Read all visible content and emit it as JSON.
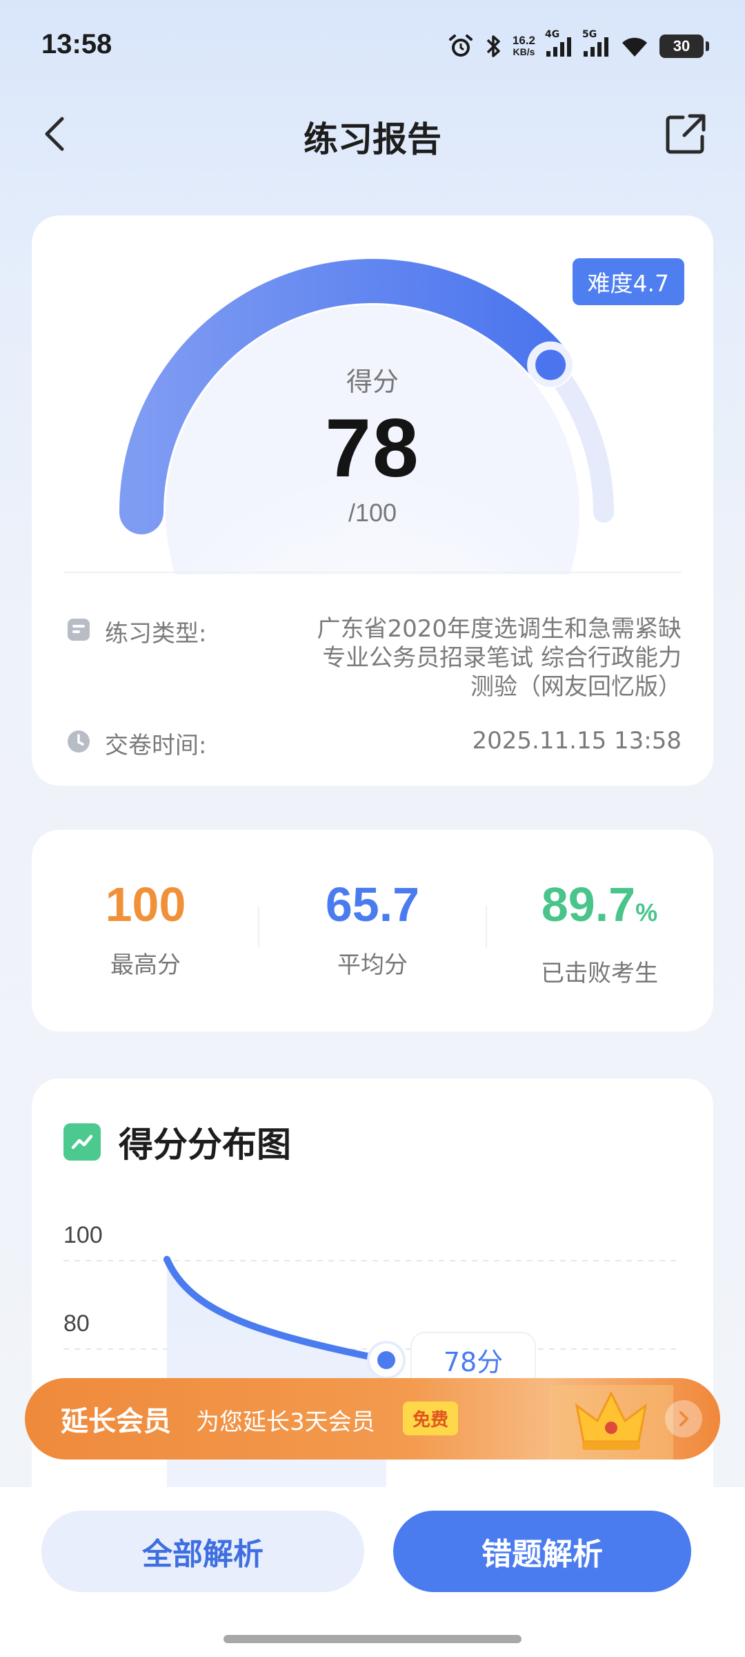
{
  "status_bar": {
    "time": "13:58",
    "network_speed_top": "16.2",
    "network_speed_bottom": "KB/s",
    "signal_1": "4G",
    "signal_2": "5G",
    "battery": "30",
    "icons": [
      "alarm-icon",
      "bluetooth-icon",
      "signal-4g-icon",
      "signal-5g-icon",
      "wifi-icon",
      "battery-icon"
    ]
  },
  "nav": {
    "title": "练习报告",
    "back_icon": "chevron-left-icon",
    "share_icon": "share-icon"
  },
  "score": {
    "difficulty": "难度4.7",
    "label": "得分",
    "value": "78",
    "max": "/100",
    "gauge_fraction": 0.78
  },
  "info": {
    "type_label": "练习类型:",
    "type_value_lines": [
      "广东省2020年度选调生和急需紧缺",
      "专业公务员招录笔试 综合行政能力",
      "测验（网友回忆版）"
    ],
    "time_label": "交卷时间:",
    "time_value": "2025.11.15 13:58"
  },
  "stats": [
    {
      "value": "100",
      "unit": "",
      "label": "最高分",
      "color": "#f0913a"
    },
    {
      "value": "65.7",
      "unit": "",
      "label": "平均分",
      "color": "#4a7cf0"
    },
    {
      "value": "89.7",
      "unit": "%",
      "label": "已击败考生",
      "color": "#49c48b"
    }
  ],
  "distribution": {
    "title": "得分分布图",
    "marker_label": "78分"
  },
  "chart_data": {
    "type": "line",
    "title": "得分分布图",
    "y_ticks": [
      "100",
      "80"
    ],
    "marker": {
      "y": 78,
      "label": "78分"
    }
  },
  "promo": {
    "title": "延长会员",
    "subtitle": "为您延长3天会员",
    "badge": "免费"
  },
  "actions": {
    "all_label": "全部解析",
    "wrong_label": "错题解析"
  },
  "colors": {
    "accent": "#4a7cf0",
    "orange": "#f0913a",
    "green": "#49c48b"
  }
}
